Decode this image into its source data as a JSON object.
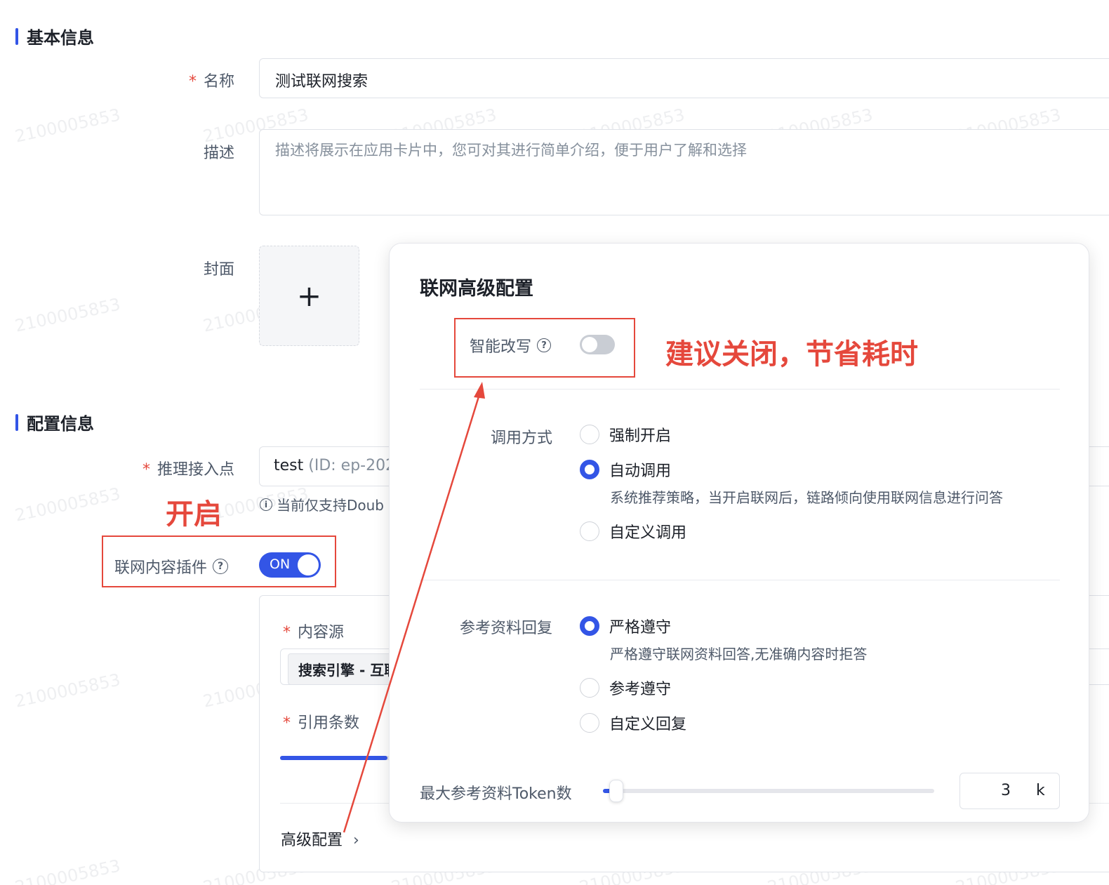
{
  "basic_section": {
    "title": "基本信息"
  },
  "config_section": {
    "title": "配置信息"
  },
  "form": {
    "required_mark": "*",
    "name_label": "名称",
    "name_value": "测试联网搜索",
    "desc_label": "描述",
    "desc_placeholder": "描述将展示在应用卡片中，您可对其进行简单介绍，便于用户了解和选择",
    "cover_label": "封面",
    "upload_glyph": "+",
    "endpoint_label": "推理接入点",
    "endpoint_value": "test",
    "endpoint_id": "(ID: ep-2025",
    "endpoint_hint": "当前仅支持Doub",
    "plugin_label": "联网内容插件",
    "plugin_switch_text": "ON",
    "source_label": "内容源",
    "source_tag": "搜索引擎 - 互联",
    "count_label": "引用条数",
    "count_slider_value": 0.85,
    "advanced_link": "高级配置",
    "advanced_chevron": "›"
  },
  "popover": {
    "title": "联网高级配置",
    "rewrite_label": "智能改写",
    "rewrite_enabled": false,
    "call_label": "调用方式",
    "call_options": [
      {
        "label": "强制开启",
        "checked": false
      },
      {
        "label": "自动调用",
        "checked": true,
        "desc": "系统推荐策略，当开启联网后，链路倾向使用联网信息进行问答"
      },
      {
        "label": "自定义调用",
        "checked": false
      }
    ],
    "reply_label": "参考资料回复",
    "reply_options": [
      {
        "label": "严格遵守",
        "checked": true,
        "desc": "严格遵守联网资料回答,无准确内容时拒答"
      },
      {
        "label": "参考遵守",
        "checked": false
      },
      {
        "label": "自定义回复",
        "checked": false
      }
    ],
    "token_label": "最大参考资料Token数",
    "token_value": "3",
    "token_unit": "k",
    "token_slider_fraction": 0.04
  },
  "annotations": {
    "enable_note": "开启",
    "rewrite_note": "建议关闭，节省耗时"
  },
  "watermark_text": "2100005853",
  "colors": {
    "accent": "#3355e6",
    "annotation": "#e5483c"
  },
  "icons": {
    "help": "question-circle-icon",
    "info": "info-circle-icon"
  }
}
